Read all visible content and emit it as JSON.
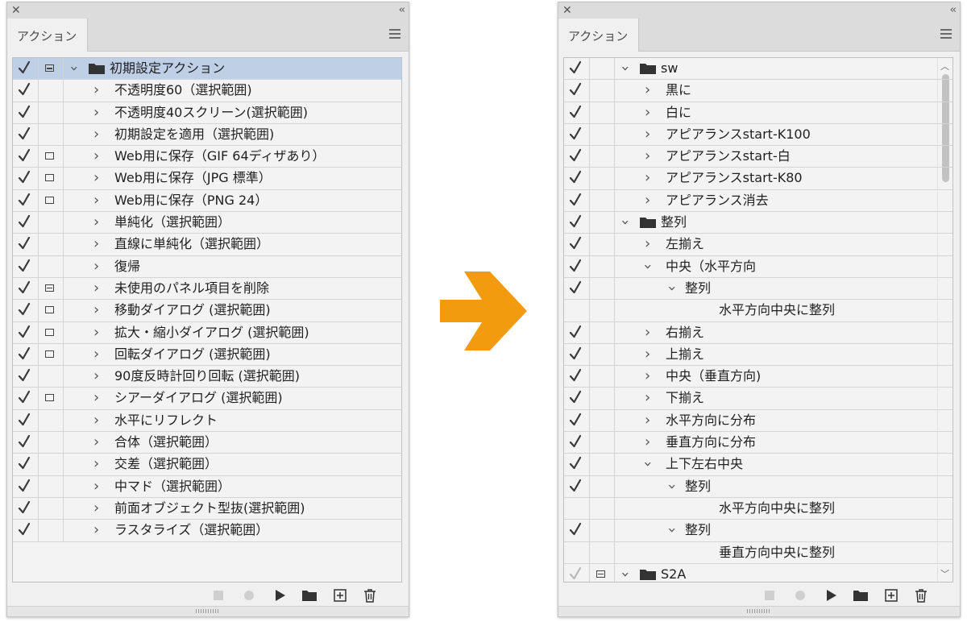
{
  "left_panel": {
    "tab_label": "アクション",
    "rows": [
      {
        "label": "初期設定アクション",
        "check": true,
        "dialog": "filled",
        "type": "folder",
        "expanded": true,
        "selected": true,
        "level": 0
      },
      {
        "label": "不透明度60（選択範囲)",
        "check": true,
        "dialog": "",
        "type": "action",
        "level": 1
      },
      {
        "label": "不透明度40スクリーン(選択範囲)",
        "check": true,
        "dialog": "",
        "type": "action",
        "level": 1
      },
      {
        "label": "初期設定を適用（選択範囲)",
        "check": true,
        "dialog": "",
        "type": "action",
        "level": 1
      },
      {
        "label": "Web用に保存（GIF 64ディザあり）",
        "check": true,
        "dialog": "empty",
        "type": "action",
        "level": 1
      },
      {
        "label": "Web用に保存（JPG 標準）",
        "check": true,
        "dialog": "empty",
        "type": "action",
        "level": 1
      },
      {
        "label": "Web用に保存（PNG 24）",
        "check": true,
        "dialog": "empty",
        "type": "action",
        "level": 1
      },
      {
        "label": "単純化（選択範囲）",
        "check": true,
        "dialog": "",
        "type": "action",
        "level": 1
      },
      {
        "label": "直線に単純化（選択範囲）",
        "check": true,
        "dialog": "",
        "type": "action",
        "level": 1
      },
      {
        "label": "復帰",
        "check": true,
        "dialog": "",
        "type": "action",
        "level": 1
      },
      {
        "label": "未使用のパネル項目を削除",
        "check": true,
        "dialog": "filled",
        "type": "action",
        "level": 1
      },
      {
        "label": "移動ダイアログ (選択範囲)",
        "check": true,
        "dialog": "empty",
        "type": "action",
        "level": 1
      },
      {
        "label": "拡大・縮小ダイアログ (選択範囲)",
        "check": true,
        "dialog": "empty",
        "type": "action",
        "level": 1
      },
      {
        "label": "回転ダイアログ (選択範囲)",
        "check": true,
        "dialog": "empty",
        "type": "action",
        "level": 1
      },
      {
        "label": "90度反時計回り回転 (選択範囲)",
        "check": true,
        "dialog": "",
        "type": "action",
        "level": 1
      },
      {
        "label": "シアーダイアログ (選択範囲)",
        "check": true,
        "dialog": "empty",
        "type": "action",
        "level": 1
      },
      {
        "label": "水平にリフレクト",
        "check": true,
        "dialog": "",
        "type": "action",
        "level": 1
      },
      {
        "label": "合体（選択範囲）",
        "check": true,
        "dialog": "",
        "type": "action",
        "level": 1
      },
      {
        "label": "交差（選択範囲）",
        "check": true,
        "dialog": "",
        "type": "action",
        "level": 1
      },
      {
        "label": "中マド（選択範囲）",
        "check": true,
        "dialog": "",
        "type": "action",
        "level": 1
      },
      {
        "label": "前面オブジェクト型抜(選択範囲)",
        "check": true,
        "dialog": "",
        "type": "action",
        "level": 1
      },
      {
        "label": "ラスタライズ（選択範囲）",
        "check": true,
        "dialog": "",
        "type": "action",
        "level": 1
      }
    ]
  },
  "right_panel": {
    "tab_label": "アクション",
    "rows": [
      {
        "label": "sw",
        "check": true,
        "dialog": "",
        "type": "folder",
        "expanded": true,
        "level": 0
      },
      {
        "label": "黒に",
        "check": true,
        "dialog": "",
        "type": "action",
        "level": 1
      },
      {
        "label": "白に",
        "check": true,
        "dialog": "",
        "type": "action",
        "level": 1
      },
      {
        "label": "アピアランスstart-K100",
        "check": true,
        "dialog": "",
        "type": "action",
        "level": 1
      },
      {
        "label": "アピアランスstart-白",
        "check": true,
        "dialog": "",
        "type": "action",
        "level": 1
      },
      {
        "label": "アピアランスstart-K80",
        "check": true,
        "dialog": "",
        "type": "action",
        "level": 1
      },
      {
        "label": "アピアランス消去",
        "check": true,
        "dialog": "",
        "type": "action",
        "level": 1
      },
      {
        "label": "整列",
        "check": true,
        "dialog": "",
        "type": "folder",
        "expanded": true,
        "level": 0
      },
      {
        "label": "左揃え",
        "check": true,
        "dialog": "",
        "type": "action",
        "level": 1
      },
      {
        "label": "中央（水平方向",
        "check": true,
        "dialog": "",
        "type": "action",
        "expanded": true,
        "level": 1
      },
      {
        "label": "整列",
        "check": true,
        "dialog": "",
        "type": "step",
        "expanded": true,
        "level": 2
      },
      {
        "label": "水平方向中央に整列",
        "check": false,
        "dialog": "",
        "type": "detail",
        "level": 3
      },
      {
        "label": "右揃え",
        "check": true,
        "dialog": "",
        "type": "action",
        "level": 1
      },
      {
        "label": "上揃え",
        "check": true,
        "dialog": "",
        "type": "action",
        "level": 1
      },
      {
        "label": "中央（垂直方向)",
        "check": true,
        "dialog": "",
        "type": "action",
        "level": 1
      },
      {
        "label": "下揃え",
        "check": true,
        "dialog": "",
        "type": "action",
        "level": 1
      },
      {
        "label": "水平方向に分布",
        "check": true,
        "dialog": "",
        "type": "action",
        "level": 1
      },
      {
        "label": "垂直方向に分布",
        "check": true,
        "dialog": "",
        "type": "action",
        "level": 1
      },
      {
        "label": "上下左右中央",
        "check": true,
        "dialog": "",
        "type": "action",
        "expanded": true,
        "level": 1
      },
      {
        "label": "整列",
        "check": true,
        "dialog": "",
        "type": "step",
        "expanded": true,
        "level": 2
      },
      {
        "label": "水平方向中央に整列",
        "check": false,
        "dialog": "",
        "type": "detail",
        "level": 3
      },
      {
        "label": "整列",
        "check": true,
        "dialog": "",
        "type": "step",
        "expanded": true,
        "level": 2
      },
      {
        "label": "垂直方向中央に整列",
        "check": false,
        "dialog": "",
        "type": "detail",
        "level": 3
      },
      {
        "label": "S2A",
        "check": true,
        "check_faded": true,
        "dialog": "filled",
        "type": "folder",
        "expanded": true,
        "level": 0
      }
    ]
  },
  "colors": {
    "arrow": "#f29b0f",
    "selected_row": "#bfcfe6"
  },
  "icons": {
    "close": "close-icon",
    "collapse": "double-chevron-icon",
    "menu": "panel-menu-icon",
    "stop": "stop-icon",
    "record": "record-icon",
    "play": "play-icon",
    "new_set": "folder-icon",
    "new_action": "new-action-icon",
    "delete": "trash-icon"
  }
}
